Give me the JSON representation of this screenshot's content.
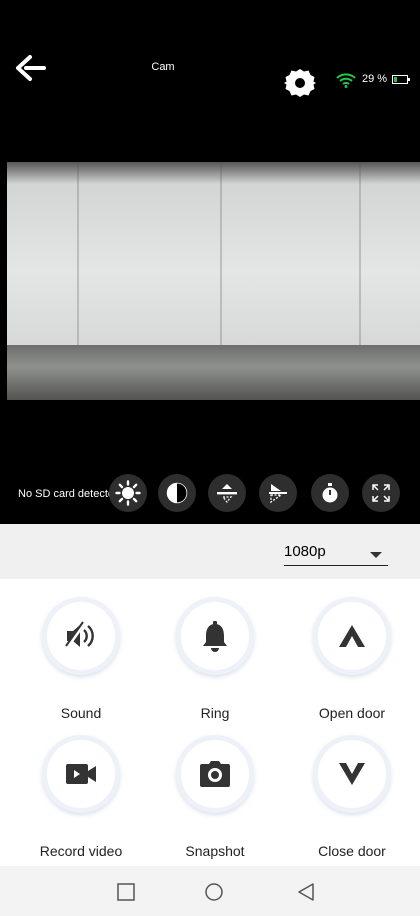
{
  "header": {
    "title": "Cam",
    "back_icon": "arrow-left-icon",
    "settings_icon": "gear-icon",
    "wifi_icon": "wifi-icon",
    "battery_text": "29 %",
    "battery_level": 0.29,
    "battery_color": "#29c447"
  },
  "video": {
    "sd_status": "No SD card detecte",
    "controls": [
      {
        "name": "brightness",
        "icon": "sun-icon"
      },
      {
        "name": "contrast",
        "icon": "contrast-icon"
      },
      {
        "name": "flip-vertical",
        "icon": "flip-vertical-icon"
      },
      {
        "name": "mirror",
        "icon": "flip-horizontal-icon"
      },
      {
        "name": "snapshot-reset",
        "icon": "timer-icon"
      },
      {
        "name": "fullscreen",
        "icon": "fullscreen-icon"
      }
    ]
  },
  "resolution": {
    "selected": "1080p"
  },
  "actions": [
    {
      "label": "Sound",
      "icon": "speaker-muted-icon"
    },
    {
      "label": "Ring",
      "icon": "bell-icon"
    },
    {
      "label": "Open door",
      "icon": "chevron-up-icon"
    },
    {
      "label": "Record video",
      "icon": "video-camera-icon"
    },
    {
      "label": "Snapshot",
      "icon": "camera-icon"
    },
    {
      "label": "Close door",
      "icon": "chevron-down-icon"
    }
  ],
  "navbar": {
    "recents_icon": "square-icon",
    "home_icon": "circle-icon",
    "back_icon": "triangle-back-icon"
  }
}
